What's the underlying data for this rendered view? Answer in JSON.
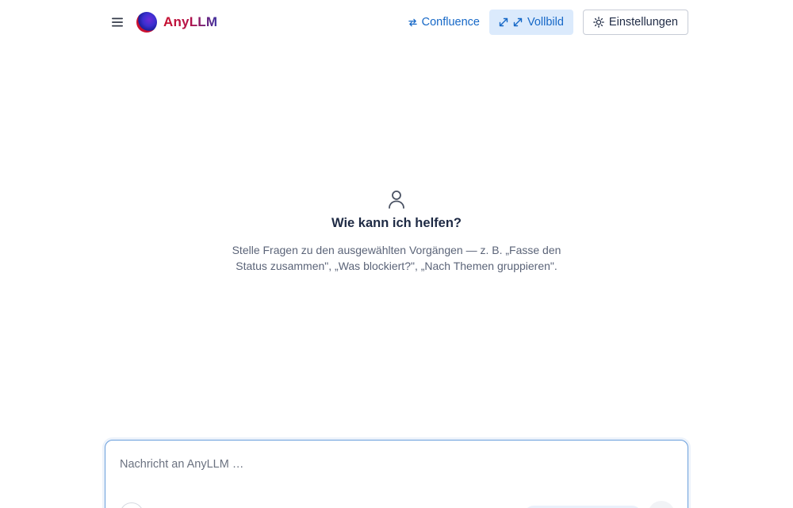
{
  "header": {
    "brand": "AnyLLM",
    "confluence_label": "Confluence",
    "fullscreen_label": "Vollbild",
    "settings_label": "Einstellungen"
  },
  "empty_state": {
    "title": "Wie kann ich helfen?",
    "hint": "Stelle Fragen zu den ausgewählten Vorgängen — z. B. „Fasse den Status zusammen\", „Was blockiert?\", „Nach Themen gruppieren\"."
  },
  "composer": {
    "placeholder": "Nachricht an AnyLLM …"
  },
  "colors": {
    "accent": "#1668c7",
    "accent_soft_bg": "#dbeafc",
    "brand_red": "#c8102e",
    "brand_purple": "#3b2fa0"
  },
  "icons": {
    "menu": "hamburger-icon",
    "confluence": "swap-arrows-icon",
    "fullscreen": "expand-arrows-icon",
    "settings": "sun-gear-icon",
    "empty": "person-icon"
  }
}
